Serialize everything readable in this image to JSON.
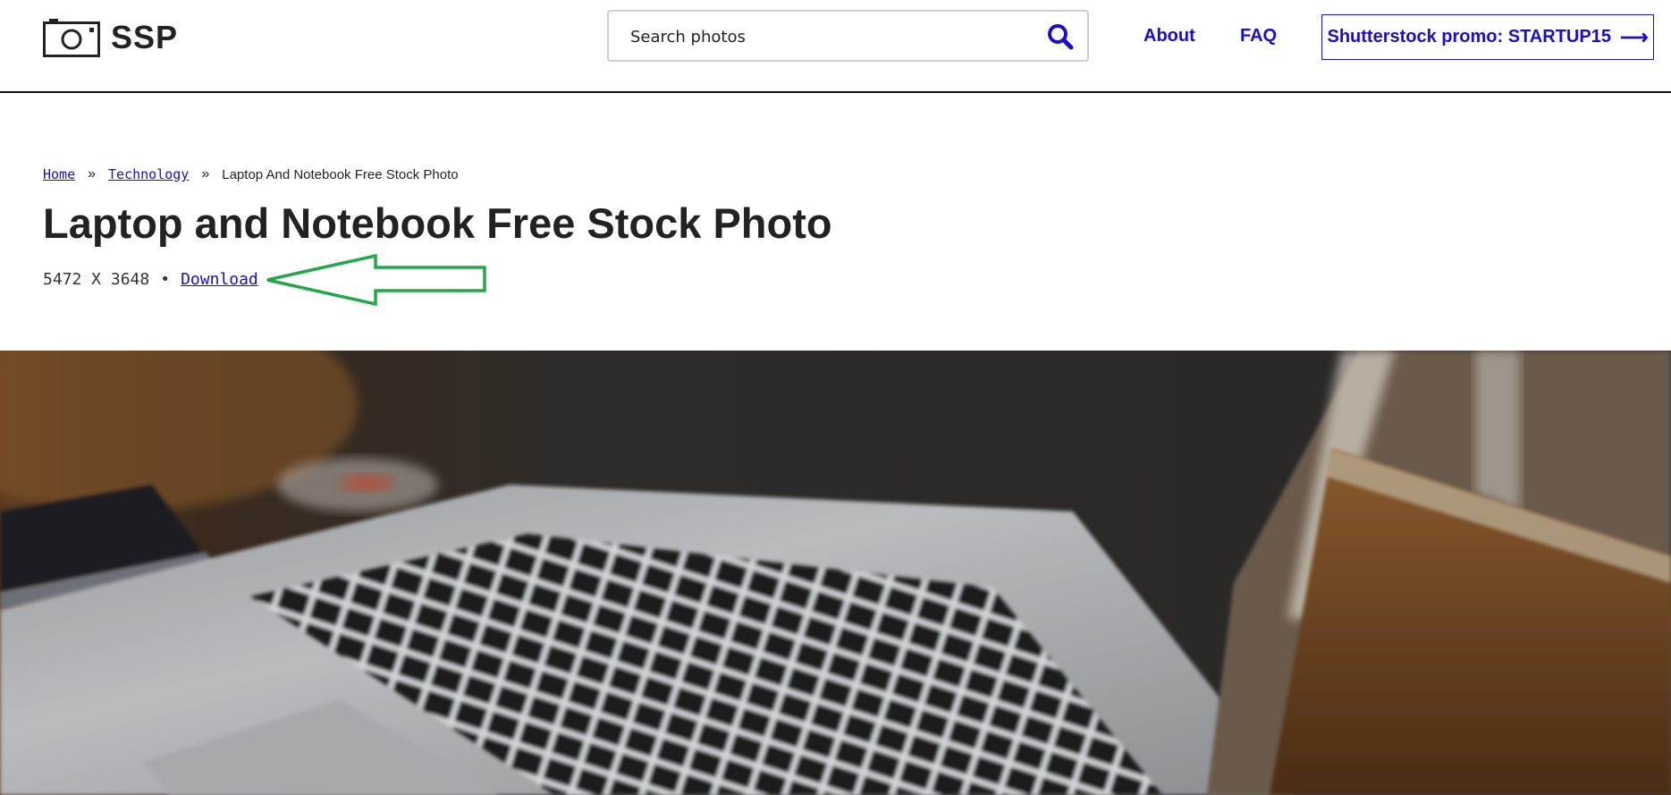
{
  "header": {
    "logo_text": "SSP",
    "search_placeholder": "Search photos",
    "nav": {
      "about": "About",
      "faq": "FAQ"
    },
    "promo_label": "Shutterstock promo: STARTUP15",
    "promo_arrow": "⟶"
  },
  "breadcrumb": {
    "home": "Home",
    "separator": "»",
    "category": "Technology",
    "current": "Laptop And Notebook Free Stock Photo"
  },
  "page": {
    "title": "Laptop and Notebook Free Stock Photo",
    "dimensions": "5472 X 3648",
    "meta_separator": "•",
    "download_label": "Download"
  },
  "colors": {
    "link": "#1a0dcc",
    "annotation_arrow": "#22a84a"
  },
  "icons": {
    "logo": "camera-icon",
    "search": "search-icon",
    "promo": "arrow-right-icon"
  }
}
